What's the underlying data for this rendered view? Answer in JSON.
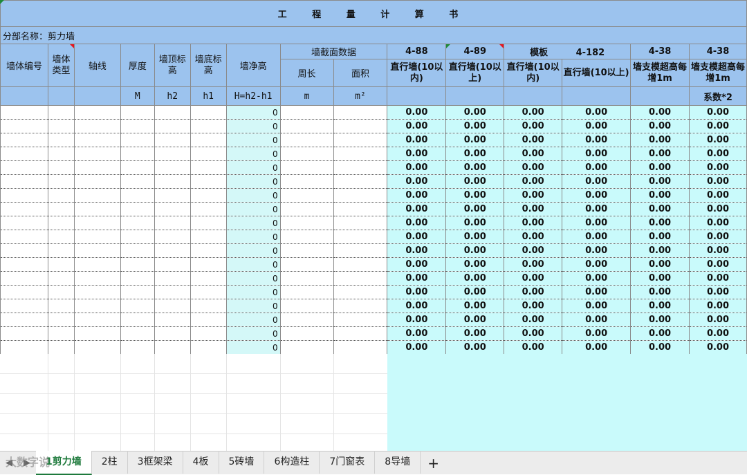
{
  "title": "工 程 量 计 算 书",
  "subtitle": "分部名称：剪力墙",
  "headers": {
    "wall_id": "墙体编号",
    "wall_type": "墙体类型",
    "axis": "轴线",
    "thickness": "厚度",
    "top_elev": "墙顶标高",
    "bottom_elev": "墙底标高",
    "net_height": "墙净高",
    "section_group": "墙截面数据",
    "perimeter": "周长",
    "area": "面积",
    "code1": "4-88",
    "code2": "4-89",
    "code3a": "模板",
    "code3b": "4-182",
    "code4": "4-38",
    "code5": "4-38",
    "desc1": "直行墙(10以内)",
    "desc2": "直行墙(10以上)",
    "desc3": "直行墙(10以内)",
    "desc4": "直行墙(10以上)",
    "desc5": "墙支模超高每增1m",
    "desc6": "墙支模超高每增1m"
  },
  "units": {
    "thickness": "M",
    "top_elev": "h2",
    "bottom_elev": "h1",
    "net_height": "H=h2-h1",
    "perimeter": "m",
    "area": "m²",
    "factor": "系数*2"
  },
  "rows": [
    {
      "h": "0",
      "v": [
        "0.00",
        "0.00",
        "0.00",
        "0.00",
        "0.00",
        "0.00"
      ]
    },
    {
      "h": "0",
      "v": [
        "0.00",
        "0.00",
        "0.00",
        "0.00",
        "0.00",
        "0.00"
      ]
    },
    {
      "h": "0",
      "v": [
        "0.00",
        "0.00",
        "0.00",
        "0.00",
        "0.00",
        "0.00"
      ]
    },
    {
      "h": "0",
      "v": [
        "0.00",
        "0.00",
        "0.00",
        "0.00",
        "0.00",
        "0.00"
      ]
    },
    {
      "h": "0",
      "v": [
        "0.00",
        "0.00",
        "0.00",
        "0.00",
        "0.00",
        "0.00"
      ]
    },
    {
      "h": "0",
      "v": [
        "0.00",
        "0.00",
        "0.00",
        "0.00",
        "0.00",
        "0.00"
      ]
    },
    {
      "h": "0",
      "v": [
        "0.00",
        "0.00",
        "0.00",
        "0.00",
        "0.00",
        "0.00"
      ]
    },
    {
      "h": "0",
      "v": [
        "0.00",
        "0.00",
        "0.00",
        "0.00",
        "0.00",
        "0.00"
      ]
    },
    {
      "h": "0",
      "v": [
        "0.00",
        "0.00",
        "0.00",
        "0.00",
        "0.00",
        "0.00"
      ]
    },
    {
      "h": "0",
      "v": [
        "0.00",
        "0.00",
        "0.00",
        "0.00",
        "0.00",
        "0.00"
      ]
    },
    {
      "h": "0",
      "v": [
        "0.00",
        "0.00",
        "0.00",
        "0.00",
        "0.00",
        "0.00"
      ]
    },
    {
      "h": "0",
      "v": [
        "0.00",
        "0.00",
        "0.00",
        "0.00",
        "0.00",
        "0.00"
      ]
    },
    {
      "h": "0",
      "v": [
        "0.00",
        "0.00",
        "0.00",
        "0.00",
        "0.00",
        "0.00"
      ]
    },
    {
      "h": "0",
      "v": [
        "0.00",
        "0.00",
        "0.00",
        "0.00",
        "0.00",
        "0.00"
      ]
    },
    {
      "h": "0",
      "v": [
        "0.00",
        "0.00",
        "0.00",
        "0.00",
        "0.00",
        "0.00"
      ]
    },
    {
      "h": "0",
      "v": [
        "0.00",
        "0.00",
        "0.00",
        "0.00",
        "0.00",
        "0.00"
      ]
    },
    {
      "h": "0",
      "v": [
        "0.00",
        "0.00",
        "0.00",
        "0.00",
        "0.00",
        "0.00"
      ]
    },
    {
      "h": "0",
      "v": [
        "0.00",
        "0.00",
        "0.00",
        "0.00",
        "0.00",
        "0.00"
      ]
    }
  ],
  "sheet_tabs": [
    "1剪力墙",
    "2柱",
    "3框架梁",
    "4板",
    "5砖墙",
    "6构造柱",
    "7门窗表",
    "8导墙"
  ],
  "active_tab": 0,
  "add_sheet": "+",
  "watermark": "大数字说",
  "colors": {
    "header_bg": "#9cc3ee",
    "data_cyan": "#c9fafb",
    "code_red": "#e8141e",
    "active_tab": "#1e7a3c"
  }
}
